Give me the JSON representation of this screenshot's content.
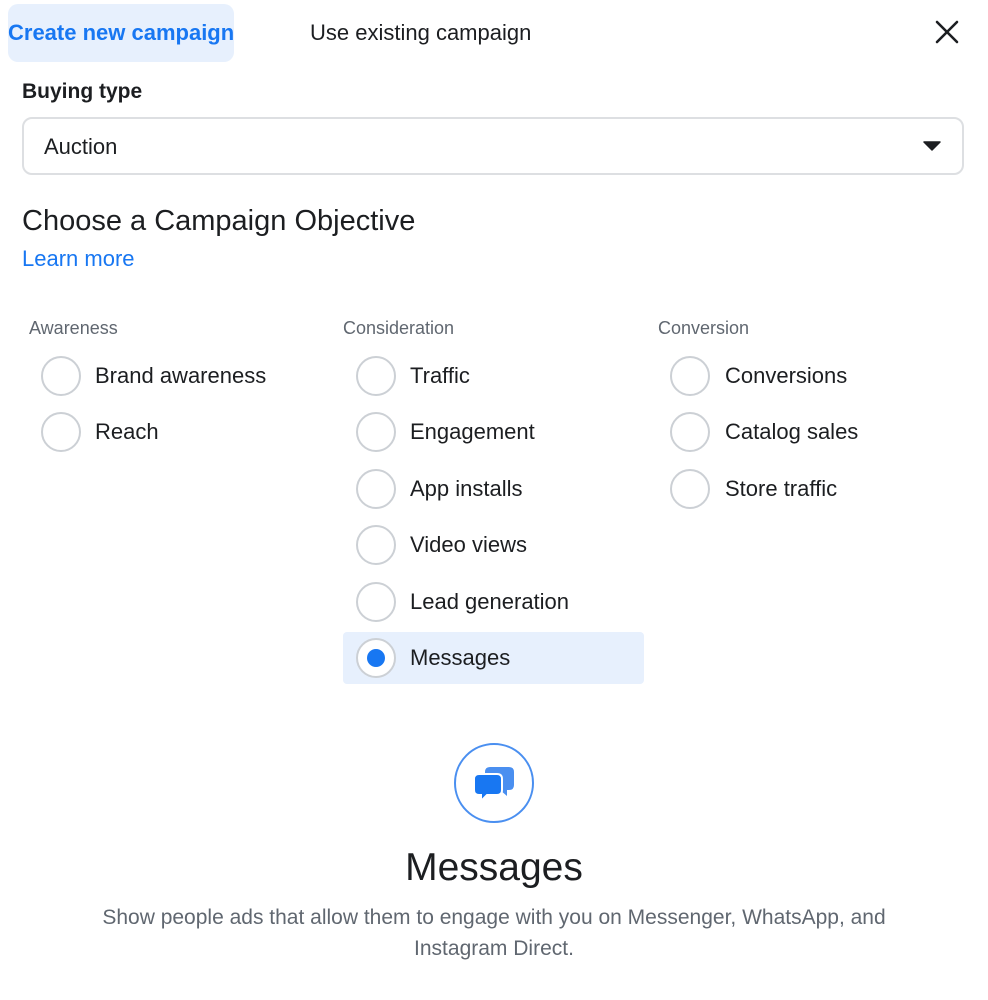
{
  "tabs": [
    {
      "label": "Create new campaign",
      "active": true
    },
    {
      "label": "Use existing campaign",
      "active": false
    }
  ],
  "close_icon": "close-icon",
  "buying_type": {
    "label": "Buying type",
    "value": "Auction",
    "icon": "chevron-down-icon"
  },
  "objective": {
    "heading": "Choose a Campaign Objective",
    "learn_more": "Learn more",
    "columns": [
      {
        "label": "Awareness",
        "options": [
          "Brand awareness",
          "Reach"
        ]
      },
      {
        "label": "Consideration",
        "options": [
          "Traffic",
          "Engagement",
          "App installs",
          "Video views",
          "Lead generation",
          "Messages"
        ]
      },
      {
        "label": "Conversion",
        "options": [
          "Conversions",
          "Catalog sales",
          "Store traffic"
        ]
      }
    ],
    "selected": "Messages"
  },
  "description": {
    "icon": "messages-icon",
    "title": "Messages",
    "text": "Show people ads that allow them to engage with you on Messenger, WhatsApp, and Instagram Direct."
  },
  "colors": {
    "accent": "#1877f2",
    "selected_bg": "#e7f0fd",
    "muted_text": "#606770",
    "border": "#dddfe2"
  }
}
